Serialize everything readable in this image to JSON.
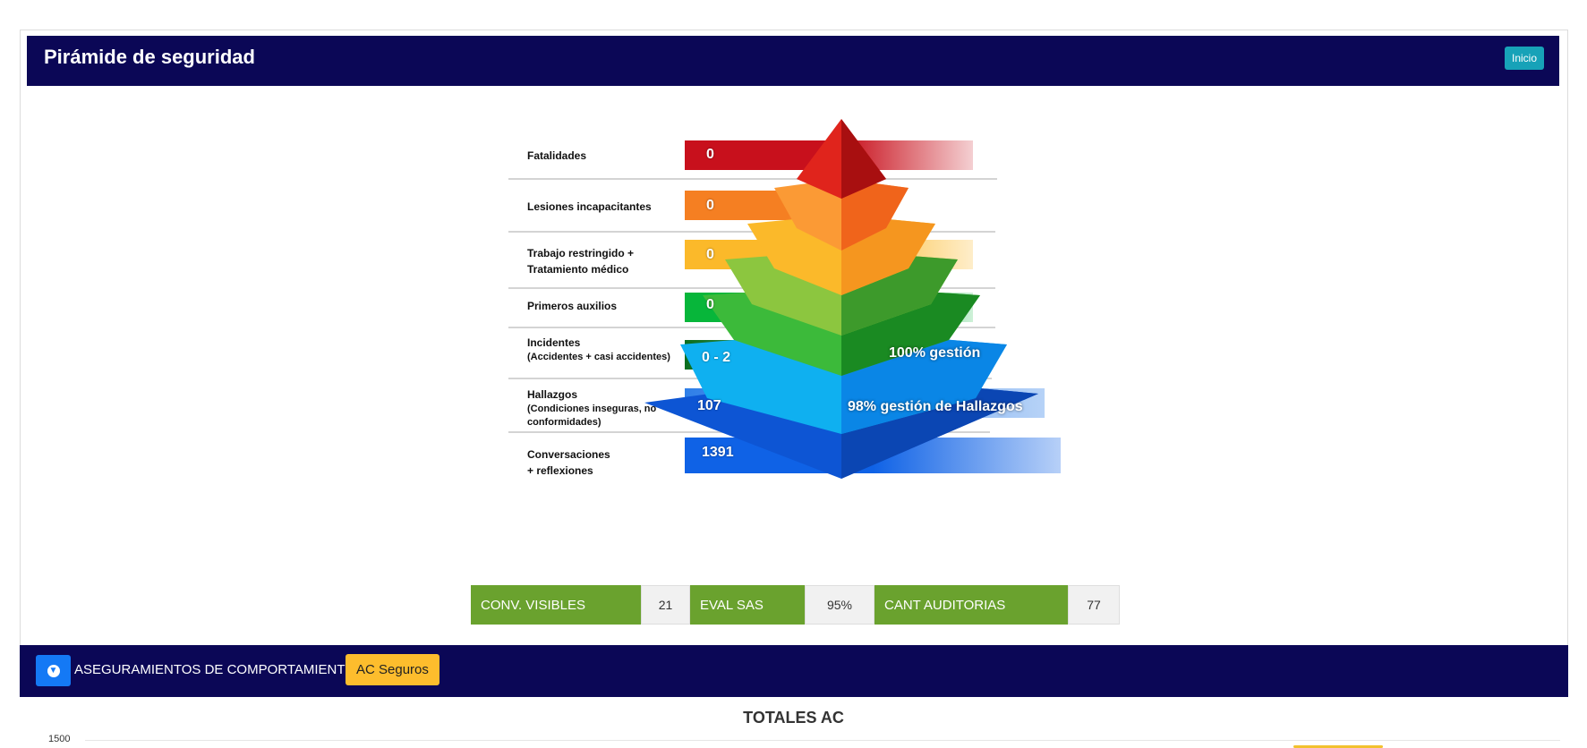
{
  "header": {
    "title": "Pirámide de seguridad",
    "home_button": "Inicio"
  },
  "pyramid": {
    "levels": [
      {
        "label": "Fatalidades",
        "value": "0",
        "color": "#c8101c"
      },
      {
        "label": "Lesiones incapacitantes",
        "value": "0",
        "color": "#f57f22"
      },
      {
        "label": "Trabajo restringido +",
        "sublabel": "Tratamiento médico",
        "value": "0",
        "color": "#fbb92a"
      },
      {
        "label": "Primeros auxilios",
        "value": "0",
        "color": "#07b63a"
      },
      {
        "label": "Incidentes",
        "sublabel": "(Accidentes + casi accidentes)",
        "value": "0 - 2",
        "color": "#0a6e1f",
        "note": "100% gestión"
      },
      {
        "label": "Hallazgos",
        "sublabel": "(Condiciones inseguras, no conformidades)",
        "value": "107",
        "color": "#2f7fe8",
        "note": "98% gestión de Hallazgos"
      },
      {
        "label": "Conversaciones",
        "sublabel": "+ reflexiones",
        "value": "1391",
        "color": "#0f62e6"
      }
    ]
  },
  "stats": [
    {
      "label": "CONV. VISIBLES",
      "value": "21"
    },
    {
      "label": "EVAL SAS",
      "value": "95%"
    },
    {
      "label": "CANT AUDITORIAS",
      "value": "77"
    }
  ],
  "section": {
    "title": "ASEGURAMIENTOS DE COMPORTAMIENTOS",
    "button": "AC Seguros",
    "toggle_icon": "arrow-circle-down-icon"
  },
  "chart_data": {
    "type": "bar",
    "title": "TOTALES AC",
    "ytick_top": "1500",
    "series": []
  },
  "colors": {
    "header_bg": "#0b0756",
    "stat_label_bg": "#6aa22e",
    "accent_button": "#fdbd2d"
  }
}
